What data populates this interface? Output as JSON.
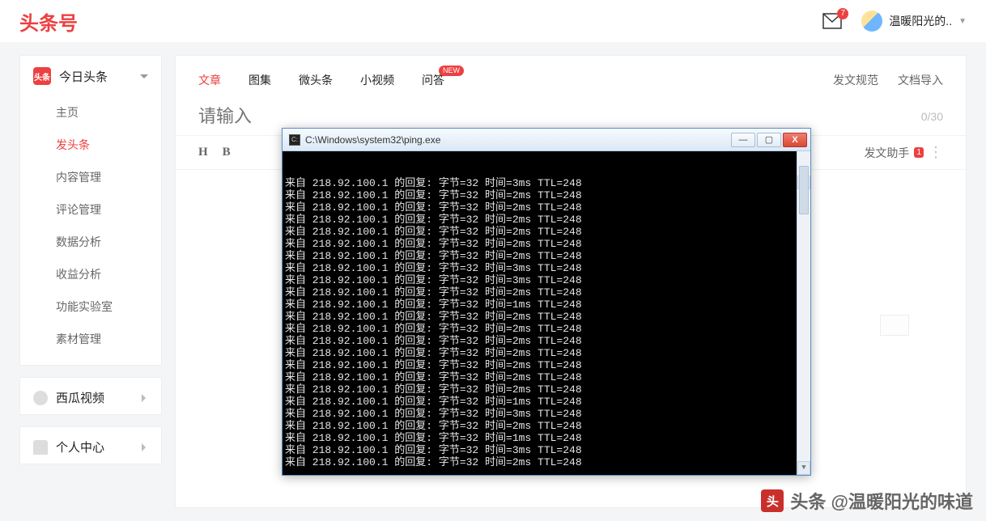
{
  "logo": "头条号",
  "mail_badge": "7",
  "user_name": "温暖阳光的..",
  "sidebar": {
    "toutiao": {
      "badge": "头条",
      "title": "今日头条",
      "items": [
        "主页",
        "发头条",
        "内容管理",
        "评论管理",
        "数据分析",
        "收益分析",
        "功能实验室",
        "素材管理"
      ],
      "active_index": 1
    },
    "xigua": {
      "title": "西瓜视频"
    },
    "personal": {
      "title": "个人中心"
    }
  },
  "tabs": {
    "items": [
      "文章",
      "图集",
      "微头条",
      "小视频",
      "问答"
    ],
    "active_index": 0,
    "new_on": 4,
    "new_text": "NEW",
    "right": [
      "发文规范",
      "文档导入"
    ]
  },
  "editor": {
    "placeholder": "请输入",
    "counter": "0/30",
    "tool_h": "H",
    "tool_b": "B",
    "helper_label": "发文助手",
    "helper_badge": "1",
    "dots": "⋮"
  },
  "terminal": {
    "title": "C:\\Windows\\system32\\ping.exe",
    "btn_min": "—",
    "btn_max": "▢",
    "btn_close": "X",
    "ip": "218.92.100.1",
    "bytes": "32",
    "ttl": "248",
    "times_ms": [
      "3",
      "2",
      "2",
      "2",
      "2",
      "2",
      "2",
      "3",
      "3",
      "2",
      "1",
      "2",
      "2",
      "2",
      "2",
      "2",
      "2",
      "2",
      "1",
      "3",
      "2",
      "1",
      "3",
      "2"
    ]
  },
  "watermark": {
    "logo": "头",
    "text": "头条 @温暖阳光的味道"
  }
}
